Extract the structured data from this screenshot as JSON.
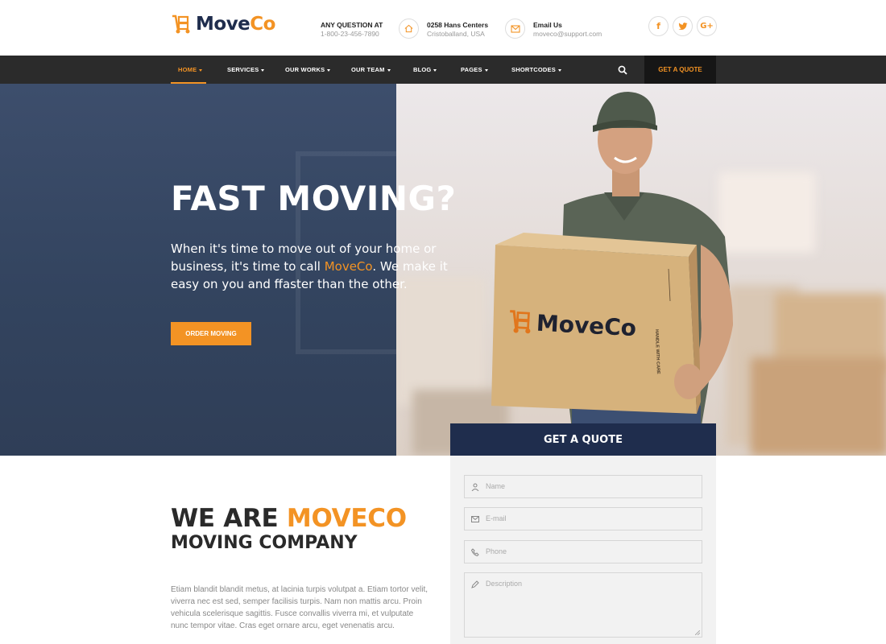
{
  "logo": {
    "part1": "Move",
    "part2": "Co"
  },
  "header": {
    "question": {
      "title": "ANY QUESTION AT",
      "value": "1-800-23-456-7890"
    },
    "address": {
      "title": "0258 Hans Centers",
      "value": "Cristoballand, USA"
    },
    "email": {
      "title": "Email Us",
      "value": "moveco@support.com"
    },
    "social": [
      {
        "icon": "facebook-icon",
        "glyph": "f"
      },
      {
        "icon": "twitter-icon",
        "glyph": "t"
      },
      {
        "icon": "google-plus-icon",
        "glyph": "G+"
      }
    ]
  },
  "nav": {
    "items": [
      "HOME",
      "SERVICES",
      "OUR WORKS",
      "OUR TEAM",
      "BLOG",
      "PAGES",
      "SHORTCODES"
    ],
    "quote_label": "GET A QUOTE"
  },
  "hero": {
    "title": "FAST MOVING?",
    "text_before": "When it's time to move out of your home or business, it's time to call ",
    "text_highlight": "MoveCo",
    "text_after": ". We make it easy on you and ffaster than the other.",
    "button_label": "ORDER MOVING",
    "box_brand": "MoveCo",
    "box_side": "HANDLE WITH CARE"
  },
  "quote_form": {
    "title": "GET A QUOTE",
    "fields": {
      "name": "Name",
      "email": "E-mail",
      "phone": "Phone",
      "description": "Description"
    }
  },
  "about": {
    "title_plain": "WE ARE ",
    "title_highlight": "MOVECO",
    "subtitle": "MOVING COMPANY",
    "paragraph": "Etiam blandit blandit metus, at lacinia turpis volutpat a. Etiam tortor velit, viverra nec est sed, semper facilisis turpis. Nam non mattis arcu. Proin vehicula scelerisque sagittis. Fusce convallis viverra mi, et vulputate nunc tempor vitae. Cras eget ornare arcu, eget venenatis arcu."
  },
  "colors": {
    "accent": "#f39324",
    "navy": "#1f2d4d",
    "nav_bg": "#2b2b2b"
  }
}
